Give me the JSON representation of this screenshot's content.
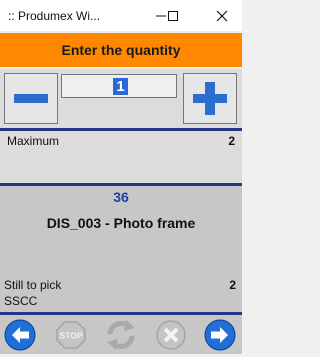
{
  "window": {
    "title": ":: Produmex Wi..."
  },
  "header": {
    "title": "Enter the quantity"
  },
  "quantity": {
    "value": "1"
  },
  "maximum": {
    "label": "Maximum",
    "value": "2"
  },
  "item": {
    "location": "36",
    "description": "DIS_003 - Photo frame",
    "still_to_pick_label": "Still to pick",
    "still_to_pick_value": "2",
    "sscc_label": "SSCC"
  },
  "icons": [
    "window-icon",
    "minimize-icon",
    "maximize-icon",
    "close-icon",
    "minus-icon",
    "plus-icon",
    "back-arrow-icon",
    "stop-icon",
    "refresh-icon",
    "cancel-icon",
    "next-arrow-icon"
  ],
  "colors": {
    "header": "#ff8800",
    "separator": "#273780",
    "nav_blue": "#1f6fd6",
    "location_text": "#1f3f9f",
    "selection": "#2a68d8"
  }
}
